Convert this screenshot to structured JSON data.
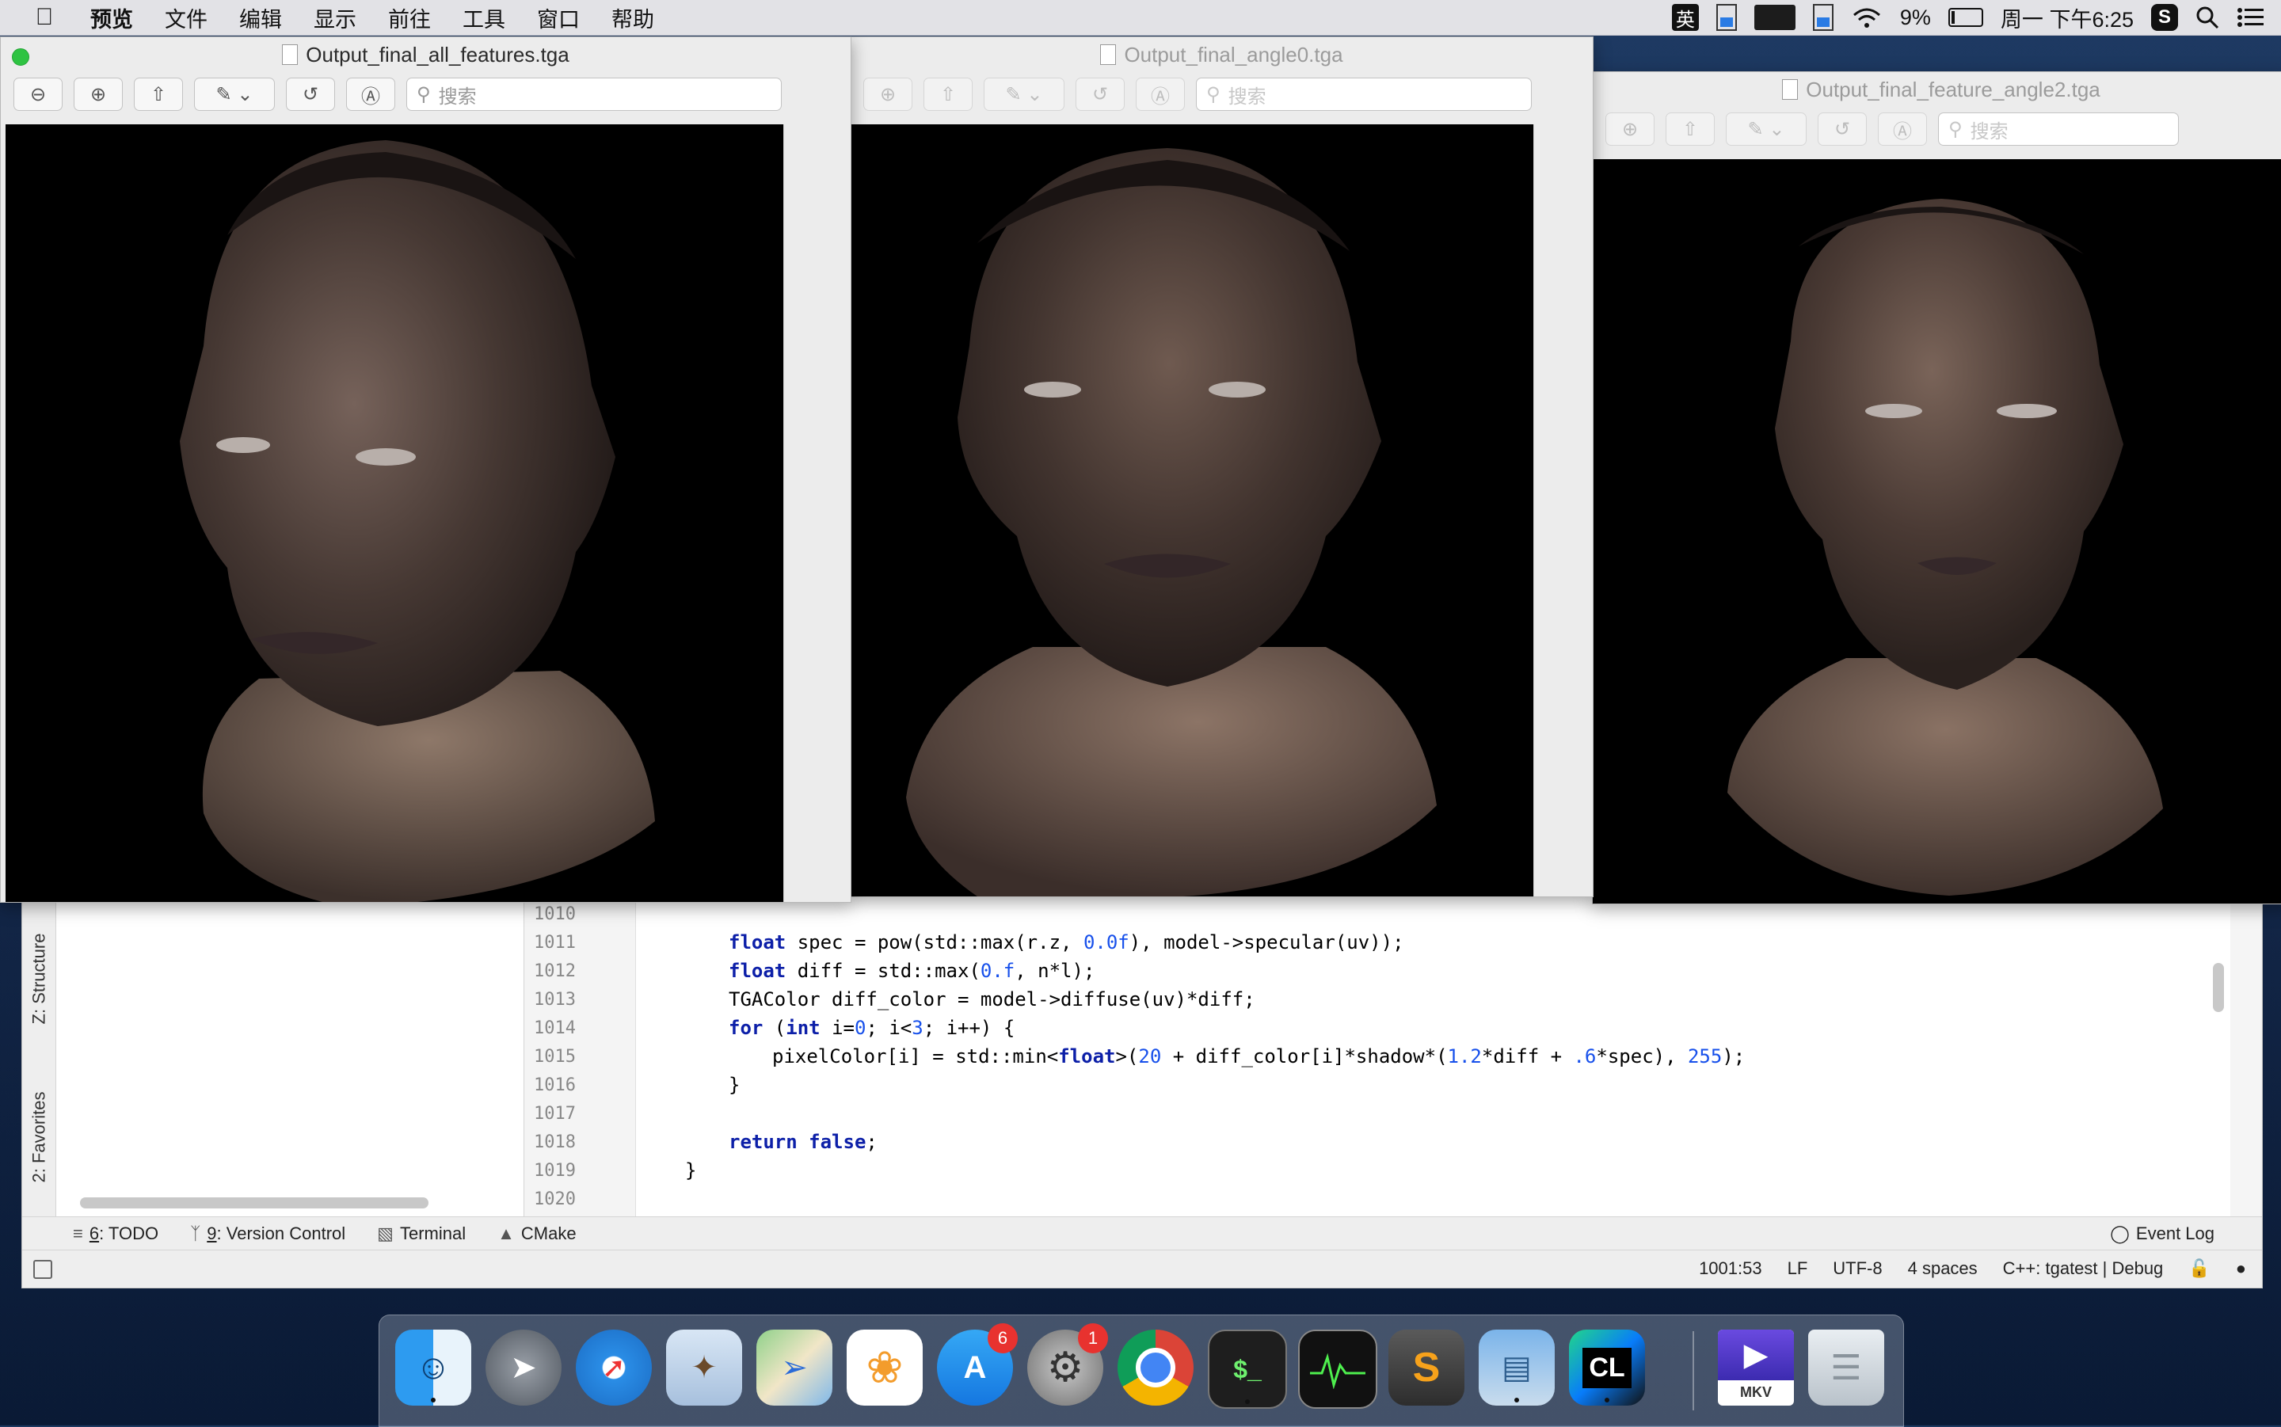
{
  "menubar": {
    "app_name": "预览",
    "items": [
      "文件",
      "编辑",
      "显示",
      "前往",
      "工具",
      "窗口",
      "帮助"
    ],
    "ime": "英",
    "battery": "9%",
    "clock": "周一 下午6:25"
  },
  "windows": [
    {
      "title": "Output_final_all_features.tga",
      "search_placeholder": "搜索",
      "active": true
    },
    {
      "title": "Output_final_angle0.tga",
      "search_placeholder": "搜索",
      "active": false
    },
    {
      "title": "Output_final_feature_angle2.tga",
      "search_placeholder": "搜索",
      "active": false
    }
  ],
  "ide": {
    "side_tabs": [
      "Z: Structure",
      "2: Favorites"
    ],
    "line_numbers": [
      "1010",
      "1011",
      "1012",
      "1013",
      "1014",
      "1015",
      "1016",
      "1017",
      "1018",
      "1019",
      "1020"
    ],
    "code": {
      "l1011_kw": "float",
      "l1011_a": " spec = pow(std::max(r.z, ",
      "l1011_num": "0.0f",
      "l1011_b": "), model->specular(uv));",
      "l1012_kw": "float",
      "l1012_a": " diff = std::max(",
      "l1012_num": "0.f",
      "l1012_b": ", n*l);",
      "l1013": "TGAColor diff_color = model->diffuse(uv)*diff;",
      "l1014_kw1": "for",
      "l1014_a": " (",
      "l1014_kw2": "int",
      "l1014_b": " i=",
      "l1014_n1": "0",
      "l1014_c": "; i<",
      "l1014_n2": "3",
      "l1014_d": "; i++) {",
      "l1015_a": "pixelColor[i] = std::min<",
      "l1015_kw": "float",
      "l1015_b": ">(",
      "l1015_n1": "20",
      "l1015_c": " + diff_color[i]*shadow*(",
      "l1015_n2": "1.2",
      "l1015_d": "*diff + ",
      "l1015_n3": ".6",
      "l1015_e": "*spec), ",
      "l1015_n4": "255",
      "l1015_f": ");",
      "l1016": "}",
      "l1018_kw1": "return",
      "l1018_kw2": "false",
      "l1018_a": ";",
      "l1019": "}"
    },
    "tool_windows": [
      {
        "num": "6",
        "label": ": TODO"
      },
      {
        "num": "9",
        "label": ": Version Control"
      },
      {
        "num": "",
        "label": "Terminal"
      },
      {
        "num": "",
        "label": "CMake"
      }
    ],
    "event_log": "Event Log",
    "status": {
      "position": "1001:53",
      "line_sep": "LF",
      "encoding": "UTF-8",
      "indent": "4 spaces",
      "context": "C++: tgatest | Debug"
    }
  },
  "dock": {
    "items": [
      {
        "name": "Finder",
        "badge": ""
      },
      {
        "name": "Launchpad",
        "badge": ""
      },
      {
        "name": "Safari",
        "badge": ""
      },
      {
        "name": "Mail",
        "badge": ""
      },
      {
        "name": "Maps",
        "badge": ""
      },
      {
        "name": "Photos",
        "badge": ""
      },
      {
        "name": "App Store",
        "badge": "6"
      },
      {
        "name": "System Preferences",
        "badge": "1"
      },
      {
        "name": "Chrome",
        "badge": ""
      },
      {
        "name": "Terminal",
        "badge": ""
      },
      {
        "name": "Activity Monitor",
        "badge": ""
      },
      {
        "name": "Sublime Text",
        "badge": ""
      },
      {
        "name": "Preview",
        "badge": ""
      },
      {
        "name": "CLion",
        "badge": ""
      },
      {
        "name": "Infuse",
        "badge": ""
      },
      {
        "name": "Trash",
        "badge": ""
      }
    ],
    "clion_label": "CL",
    "mkv_label": "MKV",
    "sublime_label": "S",
    "terminal_label": "$_"
  }
}
